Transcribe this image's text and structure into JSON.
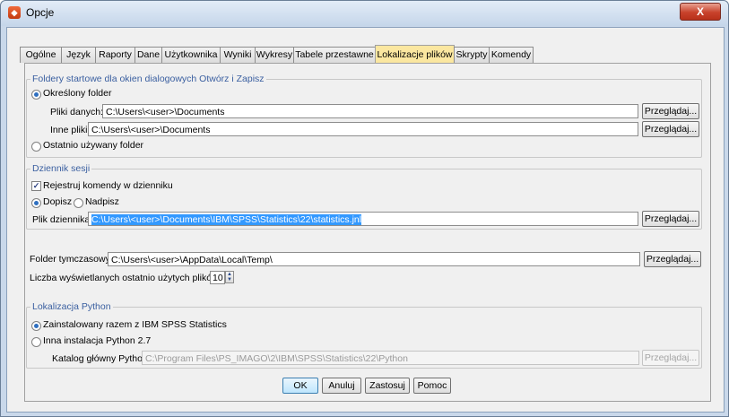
{
  "window": {
    "title": "Opcje",
    "close_label": "X"
  },
  "tabs": [
    "Ogólne",
    "Język",
    "Raporty",
    "Dane",
    "Użytkownika",
    "Wyniki",
    "Wykresy",
    "Tabele przestawne",
    "Lokalizacje plików",
    "Skrypty",
    "Komendy"
  ],
  "startup_folders": {
    "legend": "Foldery startowe dla okien dialogowych Otwórz i Zapisz",
    "specified_folder_label": "Określony folder",
    "data_files_label": "Pliki danych:",
    "data_files_value": "C:\\Users\\<user>\\Documents",
    "other_files_label": "Inne pliki:",
    "other_files_value": "C:\\Users\\<user>\\Documents",
    "last_used_label": "Ostatnio używany folder",
    "browse_label": "Przeglądaj..."
  },
  "session_journal": {
    "legend": "Dziennik sesji",
    "record_label": "Rejestruj komendy w dzienniku",
    "append_label": "Dopisz",
    "overwrite_label": "Nadpisz",
    "journal_file_label": "Plik dziennika:",
    "journal_file_value": "C:\\Users\\<user>\\Documents\\IBM\\SPSS\\Statistics\\22\\statistics.jnl",
    "browse_label": "Przeglądaj..."
  },
  "temp_folder": {
    "label": "Folder tymczasowy:",
    "value": "C:\\Users\\<user>\\AppData\\Local\\Temp\\",
    "browse_label": "Przeglądaj..."
  },
  "recent_files": {
    "label": "Liczba wyświetlanych ostatnio użytych plików:",
    "value": "10"
  },
  "python": {
    "legend": "Lokalizacja Python",
    "installed_label": "Zainstalowany razem z IBM SPSS Statistics",
    "other_label": "Inna instalacja Python 2.7",
    "home_label": "Katalog główny Python:",
    "home_value": "C:\\Program Files\\PS_IMAGO\\2\\IBM\\SPSS\\Statistics\\22\\Python",
    "browse_label": "Przeglądaj..."
  },
  "footer": {
    "ok": "OK",
    "cancel": "Anuluj",
    "apply": "Zastosuj",
    "help": "Pomoc"
  }
}
